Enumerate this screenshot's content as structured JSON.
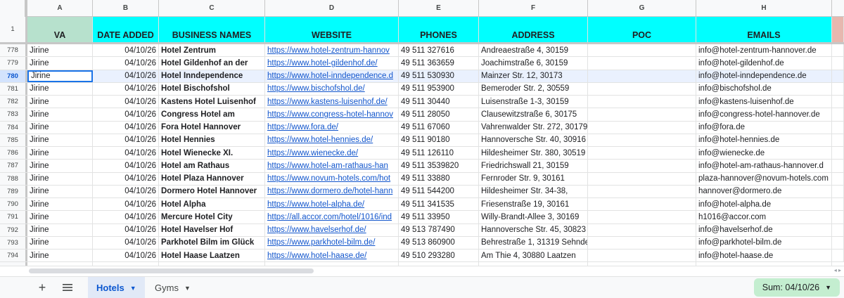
{
  "columns": [
    "A",
    "B",
    "C",
    "D",
    "E",
    "F",
    "G",
    "H"
  ],
  "header_row_number": "1",
  "headers": {
    "va": "VA",
    "date_added": "DATE ADDED",
    "business_names": "BUSINESS NAMES",
    "website": "WEBSITE",
    "phones": "PHONES",
    "address": "ADDRESS",
    "poc": "POC",
    "emails": "EMAILS"
  },
  "rows": [
    {
      "n": "778",
      "va": "Jirine",
      "date": "04/10/26",
      "name": "Hotel Zentrum",
      "web": "https://www.hotel-zentrum-hannov",
      "phone": "49 511 327616",
      "addr": "Andreaestraße 4, 30159",
      "poc": "",
      "email": "info@hotel-zentrum-hannover.de"
    },
    {
      "n": "779",
      "va": "Jirine",
      "date": "04/10/26",
      "name": "Hotel Gildenhof an der",
      "web": "https://www.hotel-gildenhof.de/",
      "phone": "49 511 363659",
      "addr": "Joachimstraße 6, 30159",
      "poc": "",
      "email": "info@hotel-gildenhof.de"
    },
    {
      "n": "780",
      "va": "Jirine",
      "date": "04/10/26",
      "name": "Hotel Inndependence",
      "web": "https://www.hotel-inndependence.d",
      "phone": "49 511 530930",
      "addr": "Mainzer Str. 12, 30173",
      "poc": "",
      "email": "info@hotel-inndependence.de"
    },
    {
      "n": "781",
      "va": "Jirine",
      "date": "04/10/26",
      "name": "Hotel Bischofshol",
      "web": "https://www.bischofshol.de/",
      "phone": "49 511 953900",
      "addr": "Bemeroder Str. 2, 30559",
      "poc": "",
      "email": "info@bischofshol.de"
    },
    {
      "n": "782",
      "va": "Jirine",
      "date": "04/10/26",
      "name": "Kastens Hotel Luisenhof",
      "web": "https://www.kastens-luisenhof.de/",
      "phone": "49 511 30440",
      "addr": "Luisenstraße 1-3, 30159",
      "poc": "",
      "email": "info@kastens-luisenhof.de"
    },
    {
      "n": "783",
      "va": "Jirine",
      "date": "04/10/26",
      "name": "Congress Hotel am",
      "web": "https://www.congress-hotel-hannov",
      "phone": "49 511 28050",
      "addr": "Clausewitzstraße 6, 30175",
      "poc": "",
      "email": "info@congress-hotel-hannover.de"
    },
    {
      "n": "784",
      "va": "Jirine",
      "date": "04/10/26",
      "name": "Fora Hotel Hannover",
      "web": "https://www.fora.de/",
      "phone": "49 511 67060",
      "addr": "Vahrenwalder Str. 272, 30179",
      "poc": "",
      "email": "info@fora.de"
    },
    {
      "n": "785",
      "va": "Jirine",
      "date": "04/10/26",
      "name": "Hotel Hennies",
      "web": "https://www.hotel-hennies.de/",
      "phone": "49 511 90180",
      "addr": "Hannoversche Str. 40, 30916",
      "poc": "",
      "email": "info@hotel-hennies.de"
    },
    {
      "n": "786",
      "va": "Jirine",
      "date": "04/10/26",
      "name": "Hotel Wienecke XI.",
      "web": "https://www.wienecke.de/",
      "phone": "49 511 126110",
      "addr": "Hildesheimer Str. 380, 30519",
      "poc": "",
      "email": "info@wienecke.de"
    },
    {
      "n": "787",
      "va": "Jirine",
      "date": "04/10/26",
      "name": "Hotel am Rathaus",
      "web": "https://www.hotel-am-rathaus-han",
      "phone": "49 511 3539820",
      "addr": "Friedrichswall 21, 30159",
      "poc": "",
      "email": "info@hotel-am-rathaus-hannover.d"
    },
    {
      "n": "788",
      "va": "Jirine",
      "date": "04/10/26",
      "name": "Hotel Plaza Hannover",
      "web": "https://www.novum-hotels.com/hot",
      "phone": "49 511 33880",
      "addr": "Fernroder Str. 9, 30161",
      "poc": "",
      "email": "plaza-hannover@novum-hotels.com"
    },
    {
      "n": "789",
      "va": "Jirine",
      "date": "04/10/26",
      "name": "Dormero Hotel Hannover",
      "web": "https://www.dormero.de/hotel-hann",
      "phone": "49 511 544200",
      "addr": "Hildesheimer Str. 34-38,",
      "poc": "",
      "email": "hannover@dormero.de"
    },
    {
      "n": "790",
      "va": "Jirine",
      "date": "04/10/26",
      "name": "Hotel Alpha",
      "web": "https://www.hotel-alpha.de/",
      "phone": "49 511 341535",
      "addr": "Friesenstraße 19, 30161",
      "poc": "",
      "email": "info@hotel-alpha.de"
    },
    {
      "n": "791",
      "va": "Jirine",
      "date": "04/10/26",
      "name": "Mercure Hotel City",
      "web": "https://all.accor.com/hotel/1016/ind",
      "phone": "49 511 33950",
      "addr": "Willy-Brandt-Allee 3, 30169",
      "poc": "",
      "email": "h1016@accor.com"
    },
    {
      "n": "792",
      "va": "Jirine",
      "date": "04/10/26",
      "name": "Hotel Havelser Hof",
      "web": "https://www.havelserhof.de/",
      "phone": "49 513 787490",
      "addr": "Hannoversche Str. 45, 30823",
      "poc": "",
      "email": "info@havelserhof.de"
    },
    {
      "n": "793",
      "va": "Jirine",
      "date": "04/10/26",
      "name": "Parkhotel Bilm im Glück",
      "web": "https://www.parkhotel-bilm.de/",
      "phone": "49 513 860900",
      "addr": "Behrestraße 1, 31319 Sehnde",
      "poc": "",
      "email": "info@parkhotel-bilm.de"
    },
    {
      "n": "794",
      "va": "Jirine",
      "date": "04/10/26",
      "name": "Hotel Haase Laatzen",
      "web": "https://www.hotel-haase.de/",
      "phone": "49 510 293280",
      "addr": "Am Thie 4, 30880 Laatzen",
      "poc": "",
      "email": "info@hotel-haase.de"
    }
  ],
  "selected_row": "780",
  "sheet_tabs": [
    {
      "label": "Hotels",
      "active": true
    },
    {
      "label": "Gyms",
      "active": false
    }
  ],
  "sum_label": "Sum: 04/10/26",
  "colors": {
    "header_cyan": "#00ffff",
    "header_va_green": "#b7e1cd",
    "selection_blue": "#1a73e8",
    "active_tab": "#0b57d0",
    "sum_chip": "#c4eed0",
    "link": "#1155cc"
  }
}
